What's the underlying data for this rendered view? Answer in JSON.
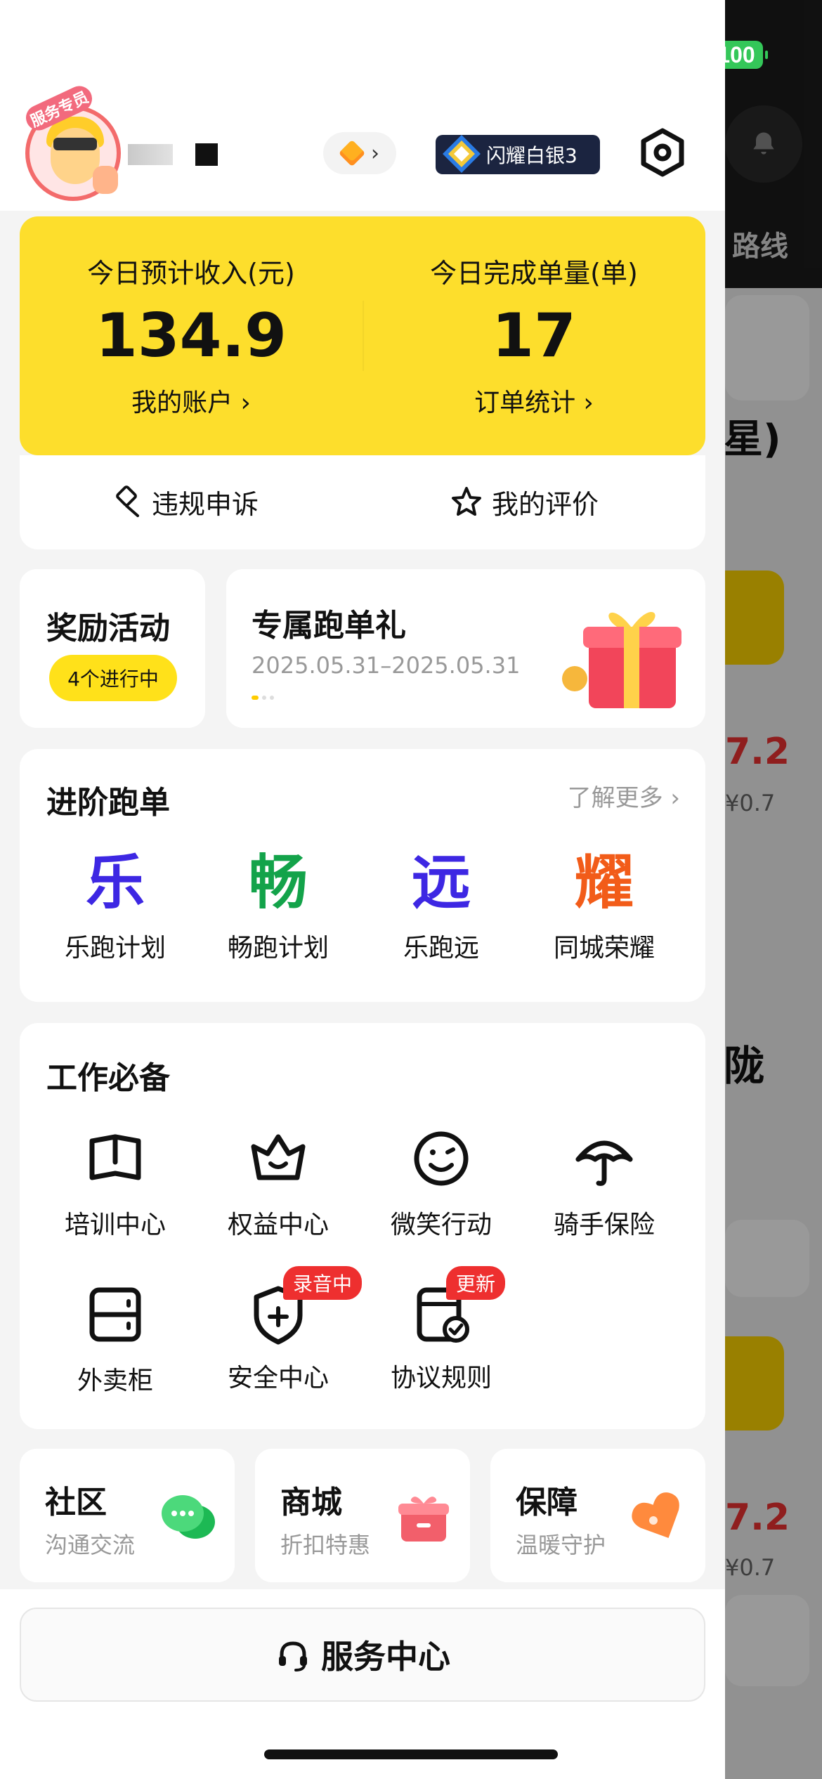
{
  "status_bar": {
    "battery": "100"
  },
  "background_app": {
    "route_label": "路线",
    "price1": "7.2",
    "sub1": "¥0.7",
    "big_text": "陇",
    "partial_text": "星)",
    "price2": "7.2",
    "sub2": "¥0.7"
  },
  "header": {
    "avatar_badge": "服务专员",
    "rank_label": "闪耀白银3"
  },
  "stats": {
    "income_label": "今日预计收入(元)",
    "income_value": "134.9",
    "account_link": "我的账户 ›",
    "orders_label": "今日完成单量(单)",
    "orders_value": "17",
    "orders_link": "订单统计 ›"
  },
  "appeal": {
    "violation": "违规申诉",
    "reviews": "我的评价"
  },
  "rewards": {
    "title": "奖励活动",
    "pill": "4个进行中"
  },
  "promo": {
    "title": "专属跑单礼",
    "date": "2025.05.31–2025.05.31"
  },
  "advanced": {
    "title": "进阶跑单",
    "learn_more": "了解更多",
    "items": [
      {
        "glyph": "乐",
        "label": "乐跑计划",
        "color": "#3d27e3"
      },
      {
        "glyph": "畅",
        "label": "畅跑计划",
        "color": "#13a34a"
      },
      {
        "glyph": "远",
        "label": "乐跑远",
        "color": "#3d27e3"
      },
      {
        "glyph": "耀",
        "label": "同城荣耀",
        "color": "#f25c19"
      }
    ]
  },
  "work": {
    "title": "工作必备",
    "items": [
      {
        "label": "培训中心",
        "icon": "book-icon"
      },
      {
        "label": "权益中心",
        "icon": "crown-icon"
      },
      {
        "label": "微笑行动",
        "icon": "smile-icon"
      },
      {
        "label": "骑手保险",
        "icon": "umbrella-icon"
      },
      {
        "label": "外卖柜",
        "icon": "locker-icon"
      },
      {
        "label": "安全中心",
        "icon": "shield-icon",
        "tag": "录音中"
      },
      {
        "label": "协议规则",
        "icon": "document-check-icon",
        "tag": "更新"
      }
    ]
  },
  "mini_cards": [
    {
      "title": "社区",
      "subtitle": "沟通交流",
      "icon": "chat-icon"
    },
    {
      "title": "商城",
      "subtitle": "折扣特惠",
      "icon": "gift-box-icon"
    },
    {
      "title": "保障",
      "subtitle": "温暖守护",
      "icon": "heart-icon"
    }
  ],
  "service": {
    "label": "服务中心"
  },
  "colors": {
    "accent_yellow": "#fdde2c",
    "tag_red": "#ee2f2f"
  }
}
